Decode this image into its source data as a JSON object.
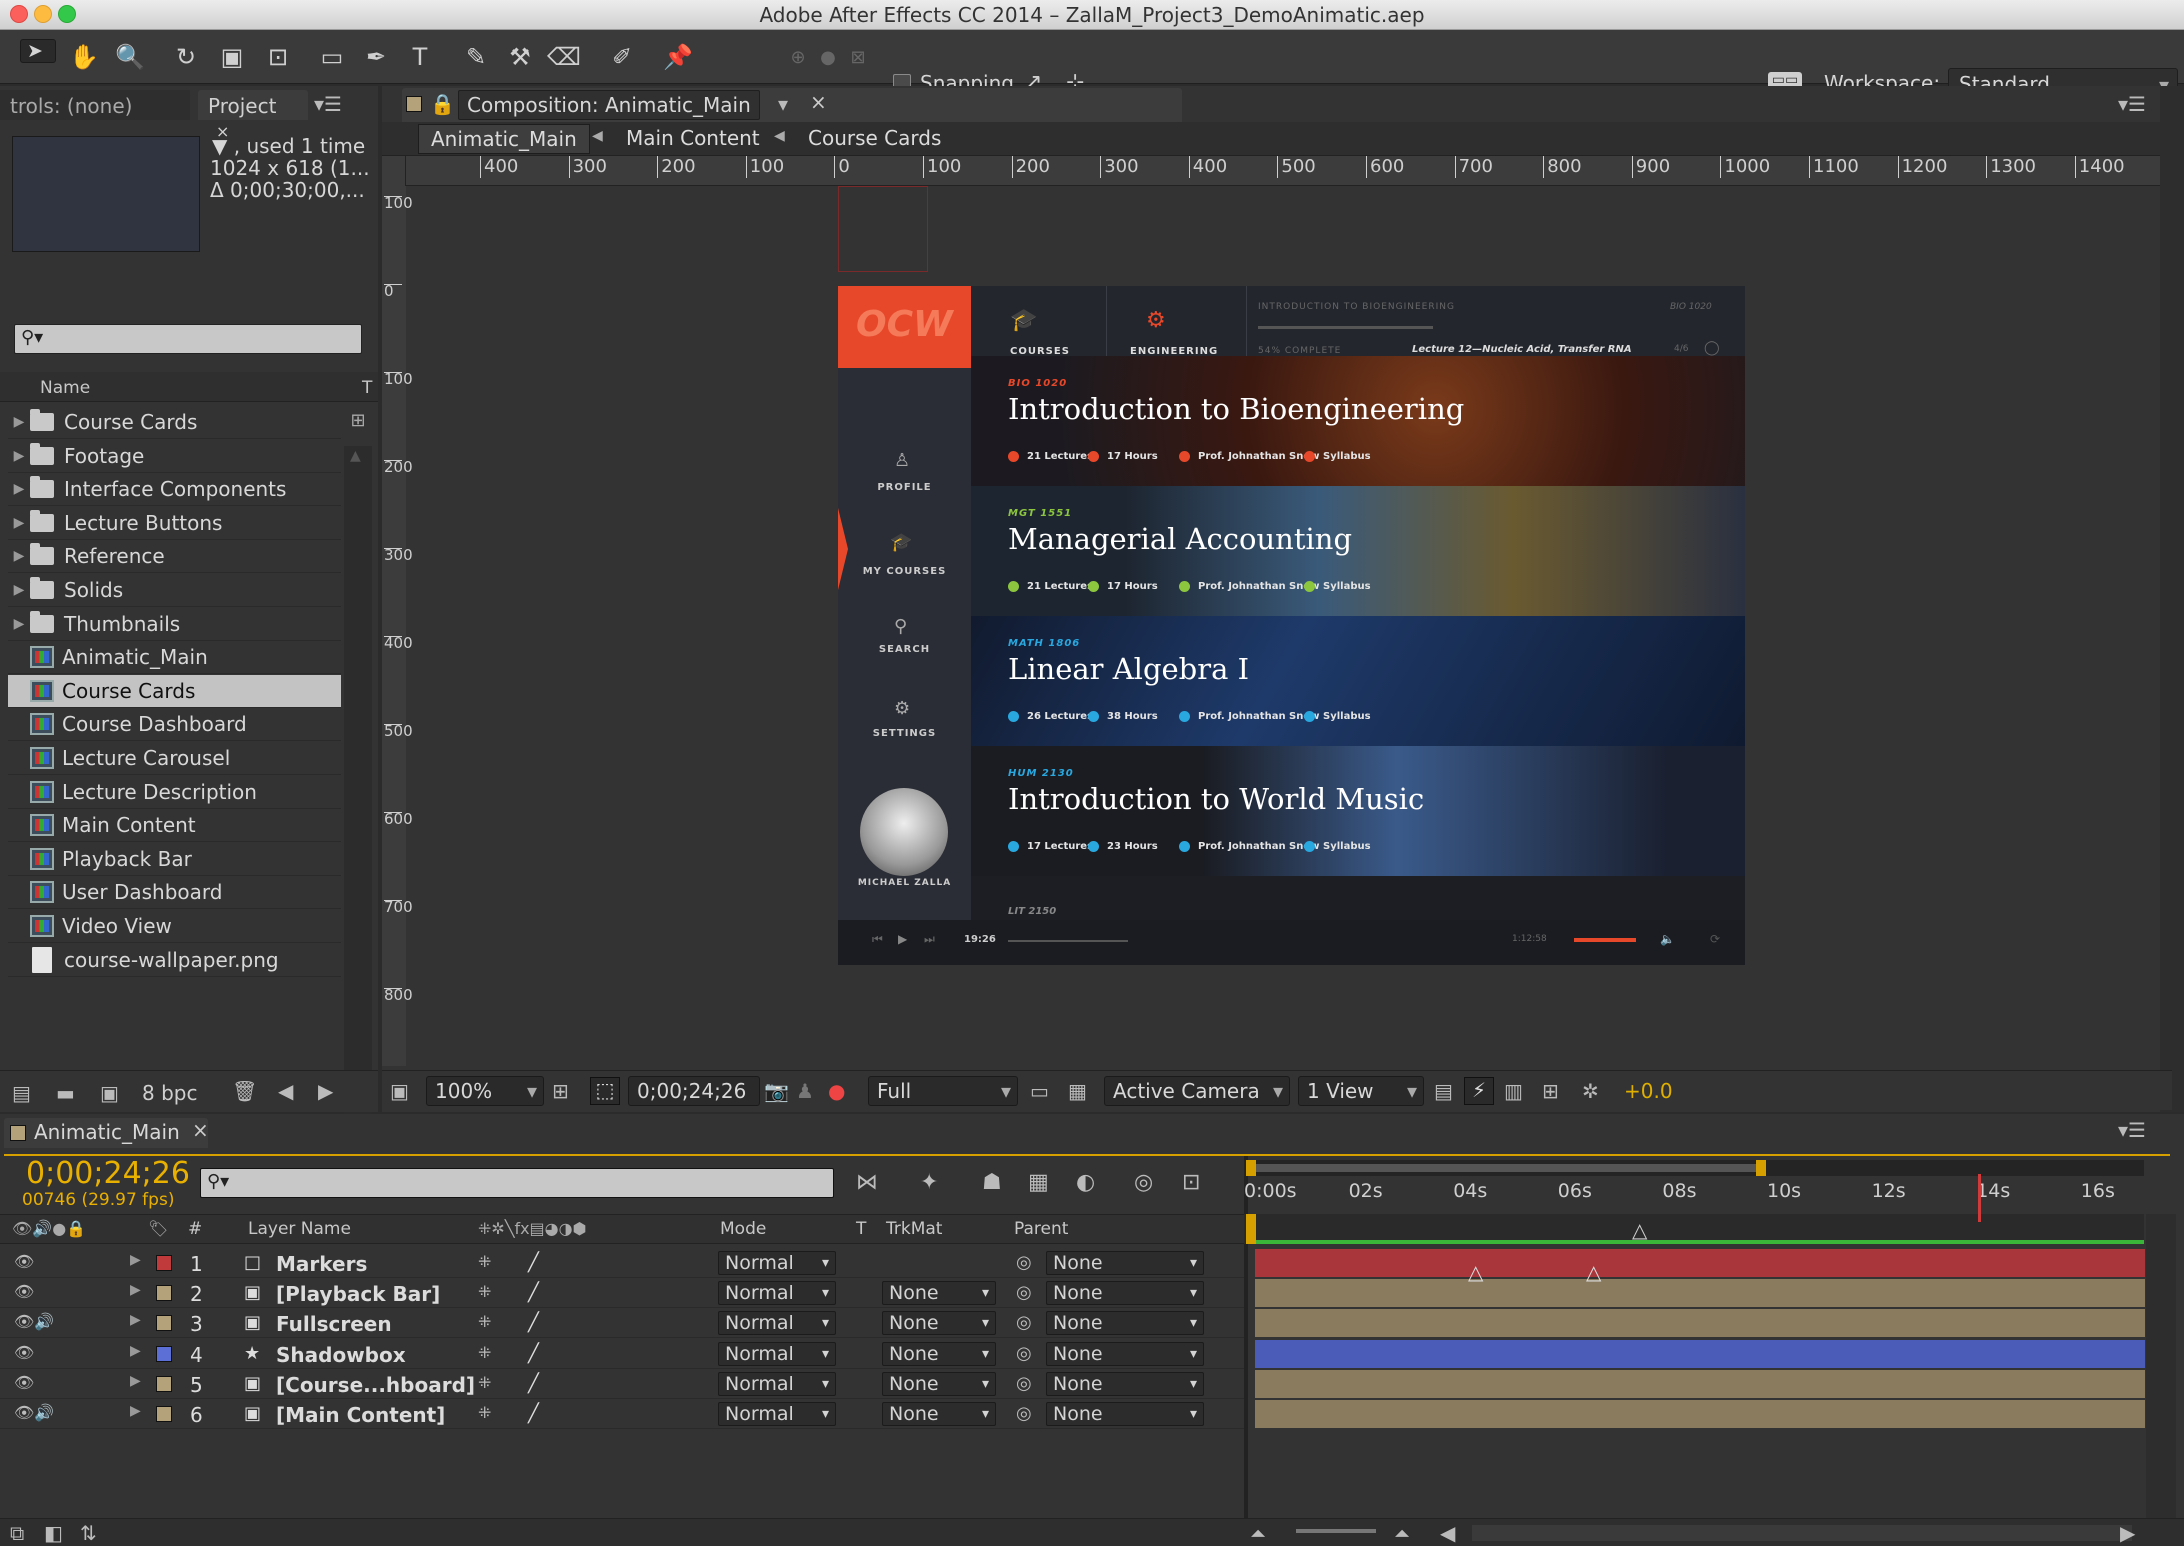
{
  "window": {
    "title": "Adobe After Effects CC 2014 – ZallaM_Project3_DemoAnimatic.aep"
  },
  "toolbar": {
    "snapping_label": "Snapping",
    "workspace_label": "Workspace:",
    "workspace_value": "Standard"
  },
  "project": {
    "effects_tab": "trols: (none)",
    "tab_label": "Project",
    "info_used": "▼ , used 1 time",
    "info_size": "1024 x 618 (1...",
    "info_duration": "Δ 0;00;30;00,...",
    "column_name": "Name",
    "column_type": "T",
    "items": [
      {
        "name": "Course Cards",
        "type": "folder"
      },
      {
        "name": "Footage",
        "type": "folder"
      },
      {
        "name": "Interface Components",
        "type": "folder"
      },
      {
        "name": "Lecture Buttons",
        "type": "folder"
      },
      {
        "name": "Reference",
        "type": "folder"
      },
      {
        "name": "Solids",
        "type": "folder"
      },
      {
        "name": "Thumbnails",
        "type": "folder"
      },
      {
        "name": "Animatic_Main",
        "type": "comp"
      },
      {
        "name": "Course Cards",
        "type": "comp",
        "selected": true
      },
      {
        "name": "Course Dashboard",
        "type": "comp"
      },
      {
        "name": "Lecture Carousel",
        "type": "comp"
      },
      {
        "name": "Lecture Description",
        "type": "comp"
      },
      {
        "name": "Main Content",
        "type": "comp"
      },
      {
        "name": "Playback Bar",
        "type": "comp"
      },
      {
        "name": "User Dashboard",
        "type": "comp"
      },
      {
        "name": "Video View",
        "type": "comp"
      },
      {
        "name": "course-wallpaper.png",
        "type": "png"
      }
    ],
    "bpc_label": "8 bpc"
  },
  "composition": {
    "tab_label": "Composition: Animatic_Main",
    "breadcrumbs": [
      "Animatic_Main",
      "Main Content",
      "Course Cards"
    ],
    "ruler_h": [
      "400",
      "300",
      "200",
      "100",
      "0",
      "100",
      "200",
      "300",
      "400",
      "500",
      "600",
      "700",
      "800",
      "900",
      "1000",
      "1100",
      "1200",
      "1300",
      "1400"
    ],
    "ruler_v": [
      "100",
      "0",
      "100",
      "200",
      "300",
      "400",
      "500",
      "600",
      "700",
      "800"
    ],
    "zoom": "100%",
    "timecode": "0;00;24;26",
    "resolution": "Full",
    "camera": "Active Camera",
    "views": "1 View",
    "exposure": "+0.0"
  },
  "preview": {
    "logo": "OCW",
    "nav_courses": "COURSES",
    "nav_engineering": "ENGINEERING",
    "breadcrumb_course": "INTRODUCTION TO BIOENGINEERING",
    "breadcrumb_code": "BIO 1020",
    "progress_text": "54% COMPLETE",
    "lecture_text": "Lecture 12—Nucleic Acid, Transfer RNA",
    "lecture_count": "4/6",
    "side_profile": "PROFILE",
    "side_mycourses": "MY COURSES",
    "side_search": "SEARCH",
    "side_settings": "SETTINGS",
    "user_name": "MICHAEL ZALLA",
    "cards": [
      {
        "code": "BIO 1020",
        "title": "Introduction to Bioengineering",
        "lectures": "21 Lectures",
        "hours": "17 Hours",
        "prof": "Prof. Johnathan Snow",
        "syllabus": "Syllabus",
        "accent": "#e8482a"
      },
      {
        "code": "MGT 1551",
        "title": "Managerial Accounting",
        "lectures": "21 Lectures",
        "hours": "17 Hours",
        "prof": "Prof. Johnathan Snow",
        "syllabus": "Syllabus",
        "accent": "#8cc63f"
      },
      {
        "code": "MATH 1806",
        "title": "Linear Algebra I",
        "lectures": "26 Lectures",
        "hours": "38 Hours",
        "prof": "Prof. Johnathan Snow",
        "syllabus": "Syllabus",
        "accent": "#29a8e0"
      },
      {
        "code": "HUM 2130",
        "title": "Introduction to World Music",
        "lectures": "17 Lectures",
        "hours": "23 Hours",
        "prof": "Prof. Johnathan Snow",
        "syllabus": "Syllabus",
        "accent": "#29a8e0"
      }
    ],
    "next_code": "LIT 2150",
    "player_time": "19:26",
    "player_remaining": "1:12:58"
  },
  "timeline": {
    "tab_label": "Animatic_Main",
    "timecode": "0;00;24;26",
    "frame_fps": "00746 (29.97 fps)",
    "col_num": "#",
    "col_layer_name": "Layer Name",
    "col_mode": "Mode",
    "col_t": "T",
    "col_trkmat": "TrkMat",
    "col_parent": "Parent",
    "time_labels": [
      "0:00s",
      "02s",
      "04s",
      "06s",
      "08s",
      "10s",
      "12s",
      "14s",
      "16s"
    ],
    "layers": [
      {
        "num": "1",
        "name": "Markers",
        "label_color": "#c0393b",
        "mode": "Normal",
        "trkmat": "",
        "parent": "None",
        "bar_color": "#a9363b",
        "kind": "solid"
      },
      {
        "num": "2",
        "name": "[Playback Bar]",
        "label_color": "#b3a27a",
        "mode": "Normal",
        "trkmat": "None",
        "parent": "None",
        "bar_color": "#8a7a5e",
        "kind": "comp"
      },
      {
        "num": "3",
        "name": "Fullscreen",
        "label_color": "#b3a27a",
        "mode": "Normal",
        "trkmat": "None",
        "parent": "None",
        "bar_color": "#8a7a5e",
        "kind": "comp"
      },
      {
        "num": "4",
        "name": "Shadowbox",
        "label_color": "#5b6fd6",
        "mode": "Normal",
        "trkmat": "None",
        "parent": "None",
        "bar_color": "#4a5cb8",
        "kind": "shape"
      },
      {
        "num": "5",
        "name": "[Course...hboard]",
        "label_color": "#b3a27a",
        "mode": "Normal",
        "trkmat": "None",
        "parent": "None",
        "bar_color": "#8a7a5e",
        "kind": "comp"
      },
      {
        "num": "6",
        "name": "[Main Content]",
        "label_color": "#b3a27a",
        "mode": "Normal",
        "trkmat": "None",
        "parent": "None",
        "bar_color": "#8a7a5e",
        "kind": "comp"
      }
    ]
  }
}
